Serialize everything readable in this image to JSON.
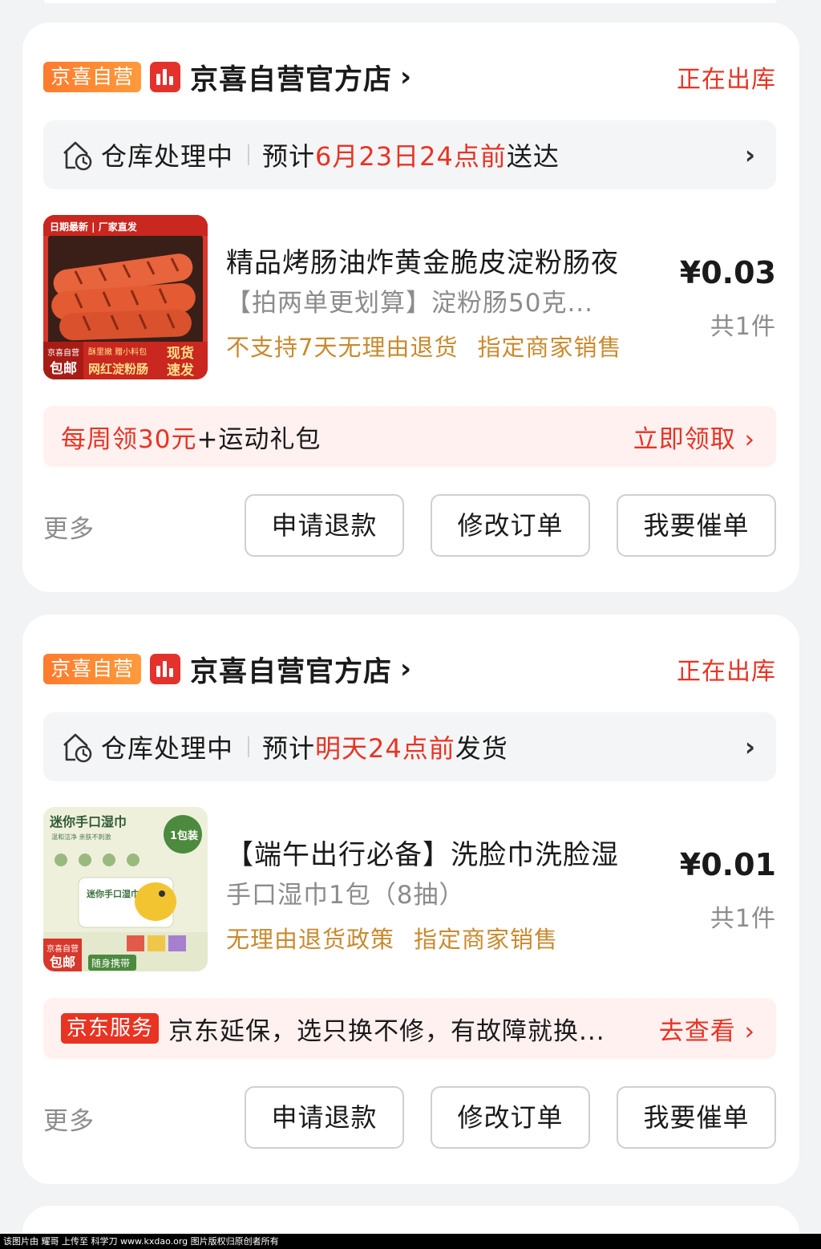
{
  "orders": [
    {
      "shop_tag": "京喜自营",
      "shop_name": "京喜自营官方店",
      "status": "正在出库",
      "tracking": {
        "status": "仓库处理中",
        "eta_prefix": "预计",
        "eta_highlight": "6月23日24点前",
        "eta_suffix": "送达"
      },
      "product": {
        "image_icon": "grilled-sausage-product-image",
        "image_text": {
          "top": "日期最新 | 厂家直发",
          "badge_line1": "京喜自营",
          "badge_line2": "包邮",
          "mid": "酥里嫩 赠小料包",
          "bottom": "网红淀粉肠",
          "corner_line1": "现货",
          "corner_line2": "速发"
        },
        "title": "精品烤肠油炸黄金脆皮淀粉肠夜",
        "subtitle": "【拍两单更划算】淀粉肠50克...",
        "tags": [
          "不支持7天无理由退货",
          "指定商家销售"
        ],
        "price": "¥0.03",
        "qty": "共1件"
      },
      "promo": {
        "badge": "",
        "text_highlight": "每周领30元",
        "text_rest": "+运动礼包",
        "action": "立即领取"
      },
      "actions": {
        "more": "更多",
        "refund": "申请退款",
        "modify": "修改订单",
        "urge": "我要催单"
      }
    },
    {
      "shop_tag": "京喜自营",
      "shop_name": "京喜自营官方店",
      "status": "正在出库",
      "tracking": {
        "status": "仓库处理中",
        "eta_prefix": "预计",
        "eta_highlight": "明天24点前",
        "eta_suffix": "发货"
      },
      "product": {
        "image_icon": "wet-wipes-product-image",
        "image_text": {
          "top": "迷你手口湿巾",
          "pack": "1包装",
          "sub": "温和洁净 亲肤不刺激",
          "badge_line1": "京喜自营",
          "badge_line2": "包邮",
          "bottom": "随身携带",
          "pack_label": "迷你手口湿巾"
        },
        "title": "【端午出行必备】洗脸巾洗脸湿",
        "subtitle": "手口湿巾1包（8抽）",
        "tags": [
          "无理由退货政策",
          "指定商家销售"
        ],
        "price": "¥0.01",
        "qty": "共1件"
      },
      "promo": {
        "badge": "京东服务",
        "text_highlight": "",
        "text_rest": "京东延保，选只换不修，有故障就换...",
        "action": "去查看"
      },
      "actions": {
        "more": "更多",
        "refund": "申请退款",
        "modify": "修改订单",
        "urge": "我要催单"
      }
    }
  ],
  "watermark": "该图片由 耀哥 上传至 科学刀 www.kxdao.org 图片版权归原创者所有",
  "colors": {
    "accent_red": "#e93323",
    "tag_gold": "#c98a2e",
    "shop_tag_orange": "#ff7a2c",
    "background": "#f2f3f5"
  }
}
